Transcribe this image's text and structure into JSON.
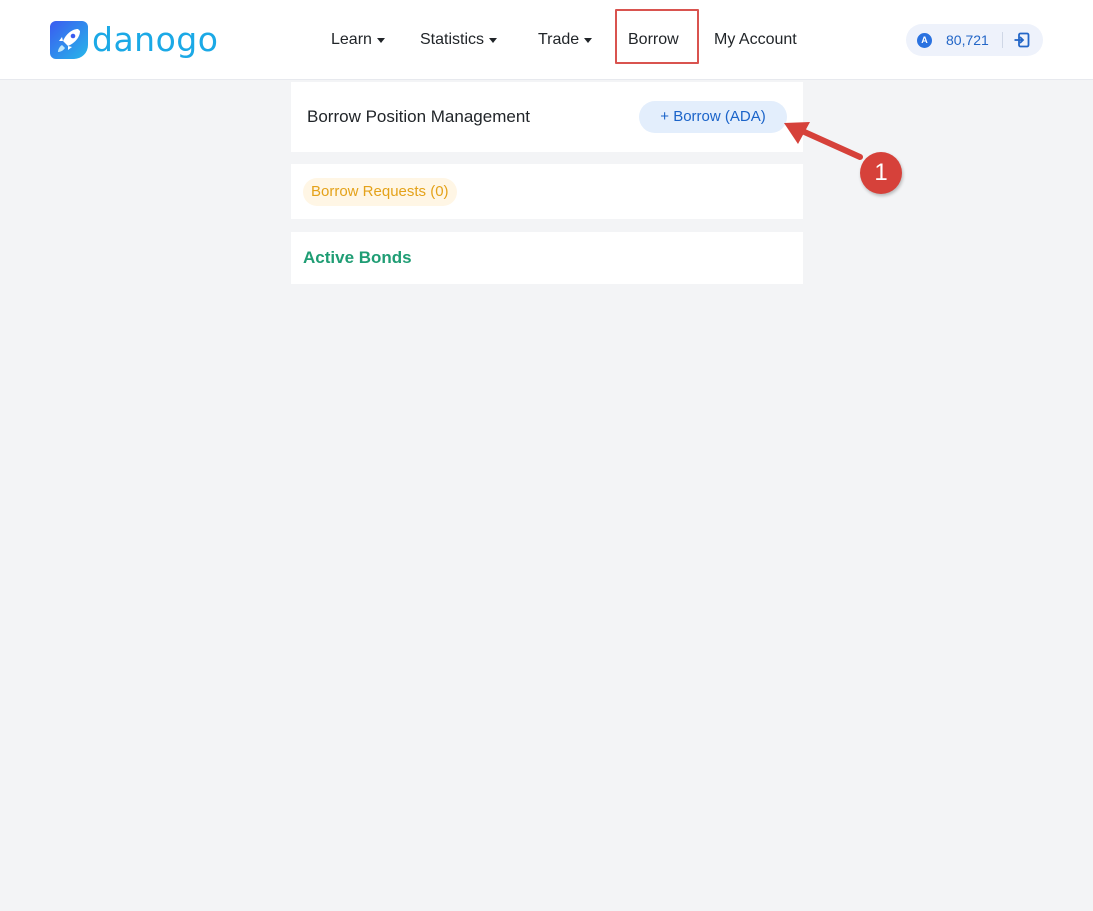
{
  "brand": {
    "name": "danogo"
  },
  "nav": {
    "items": [
      {
        "label": "Learn",
        "has_dropdown": true
      },
      {
        "label": "Statistics",
        "has_dropdown": true
      },
      {
        "label": "Trade",
        "has_dropdown": true
      },
      {
        "label": "Borrow",
        "has_dropdown": false,
        "active": true
      },
      {
        "label": "My Account",
        "has_dropdown": false
      }
    ]
  },
  "wallet": {
    "coin_symbol": "A",
    "balance": "80,721",
    "icon": "logout-icon"
  },
  "borrow_position": {
    "title": "Borrow Position Management",
    "button_label": "+ Borrow (ADA)"
  },
  "borrow_requests": {
    "label": "Borrow Requests (0)"
  },
  "active_bonds": {
    "title": "Active Bonds"
  },
  "annotation": {
    "step": "1"
  },
  "colors": {
    "brand": "#1ba9e6",
    "accent_blue": "#1a63c9",
    "requests_orange": "#e4a21a",
    "bonds_green": "#1f9d74",
    "annotation_red": "#d6413a",
    "background": "#f3f4f6"
  }
}
